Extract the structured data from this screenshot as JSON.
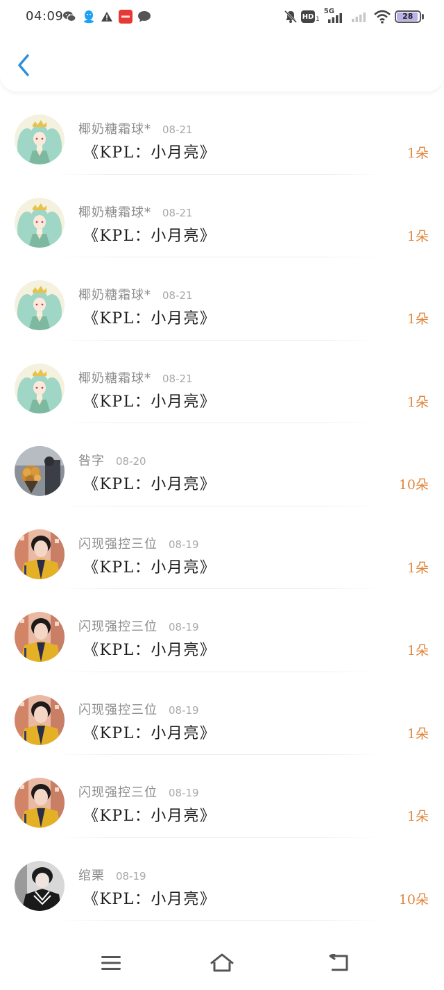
{
  "status_bar": {
    "time": "04:09",
    "network": "5G",
    "hd_label": "HD",
    "battery": "28"
  },
  "header": {
    "back_icon": "chevron-left-icon"
  },
  "gifts": [
    {
      "user": "椰奶糖霜球*",
      "date": "08-21",
      "title": "《KPL：小月亮》",
      "count": "1朵",
      "avatar": "anime-girl"
    },
    {
      "user": "椰奶糖霜球*",
      "date": "08-21",
      "title": "《KPL：小月亮》",
      "count": "1朵",
      "avatar": "anime-girl"
    },
    {
      "user": "椰奶糖霜球*",
      "date": "08-21",
      "title": "《KPL：小月亮》",
      "count": "1朵",
      "avatar": "anime-girl"
    },
    {
      "user": "椰奶糖霜球*",
      "date": "08-21",
      "title": "《KPL：小月亮》",
      "count": "1朵",
      "avatar": "anime-girl"
    },
    {
      "user": "咎字",
      "date": "08-20",
      "title": "《KPL：小月亮》",
      "count": "10朵",
      "avatar": "flowers"
    },
    {
      "user": "闪现强控三位",
      "date": "08-19",
      "title": "《KPL：小月亮》",
      "count": "1朵",
      "avatar": "boy-yellow"
    },
    {
      "user": "闪现强控三位",
      "date": "08-19",
      "title": "《KPL：小月亮》",
      "count": "1朵",
      "avatar": "boy-yellow"
    },
    {
      "user": "闪现强控三位",
      "date": "08-19",
      "title": "《KPL：小月亮》",
      "count": "1朵",
      "avatar": "boy-yellow"
    },
    {
      "user": "闪现强控三位",
      "date": "08-19",
      "title": "《KPL：小月亮》",
      "count": "1朵",
      "avatar": "boy-yellow"
    },
    {
      "user": "绾栗",
      "date": "08-19",
      "title": "《KPL：小月亮》",
      "count": "10朵",
      "avatar": "boy-dark"
    }
  ],
  "colors": {
    "accent": "#2b8fd9",
    "count": "#e0853b",
    "username": "#8d8d8d"
  }
}
